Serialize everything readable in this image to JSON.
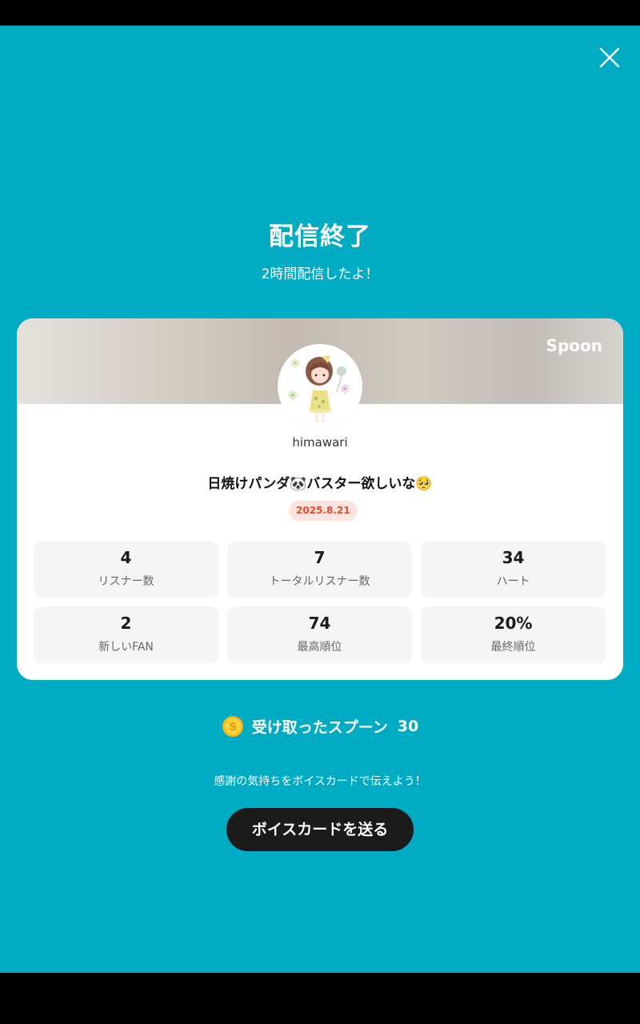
{
  "header": {
    "close_icon": "close-icon",
    "title": "配信終了",
    "subtitle": "2時間配信したよ！"
  },
  "card": {
    "brand": "Spoon",
    "username": "himawari",
    "live_title_part1": "日焼けパンダ",
    "emoji_panda": "🐼",
    "live_title_part2": "バスター欲しいな",
    "emoji_pleading": "🥺",
    "date": "2025.8.21",
    "stats": [
      {
        "value": "4",
        "label": "リスナー数"
      },
      {
        "value": "7",
        "label": "トータルリスナー数"
      },
      {
        "value": "34",
        "label": "ハート"
      },
      {
        "value": "2",
        "label": "新しいFAN"
      },
      {
        "value": "74",
        "label": "最高順位"
      },
      {
        "value": "20%",
        "label": "最終順位"
      }
    ]
  },
  "spoons": {
    "coin_symbol": "S",
    "label": "受け取ったスプーン",
    "count": "30"
  },
  "footer": {
    "hint": "感謝の気持ちをボイスカードで伝えよう！",
    "voice_card_button": "ボイスカードを送る"
  },
  "colors": {
    "background": "#00abc4",
    "date_badge_bg": "#fde3dd",
    "date_badge_text": "#ee4a2a",
    "button_bg": "#1b1b1b"
  }
}
